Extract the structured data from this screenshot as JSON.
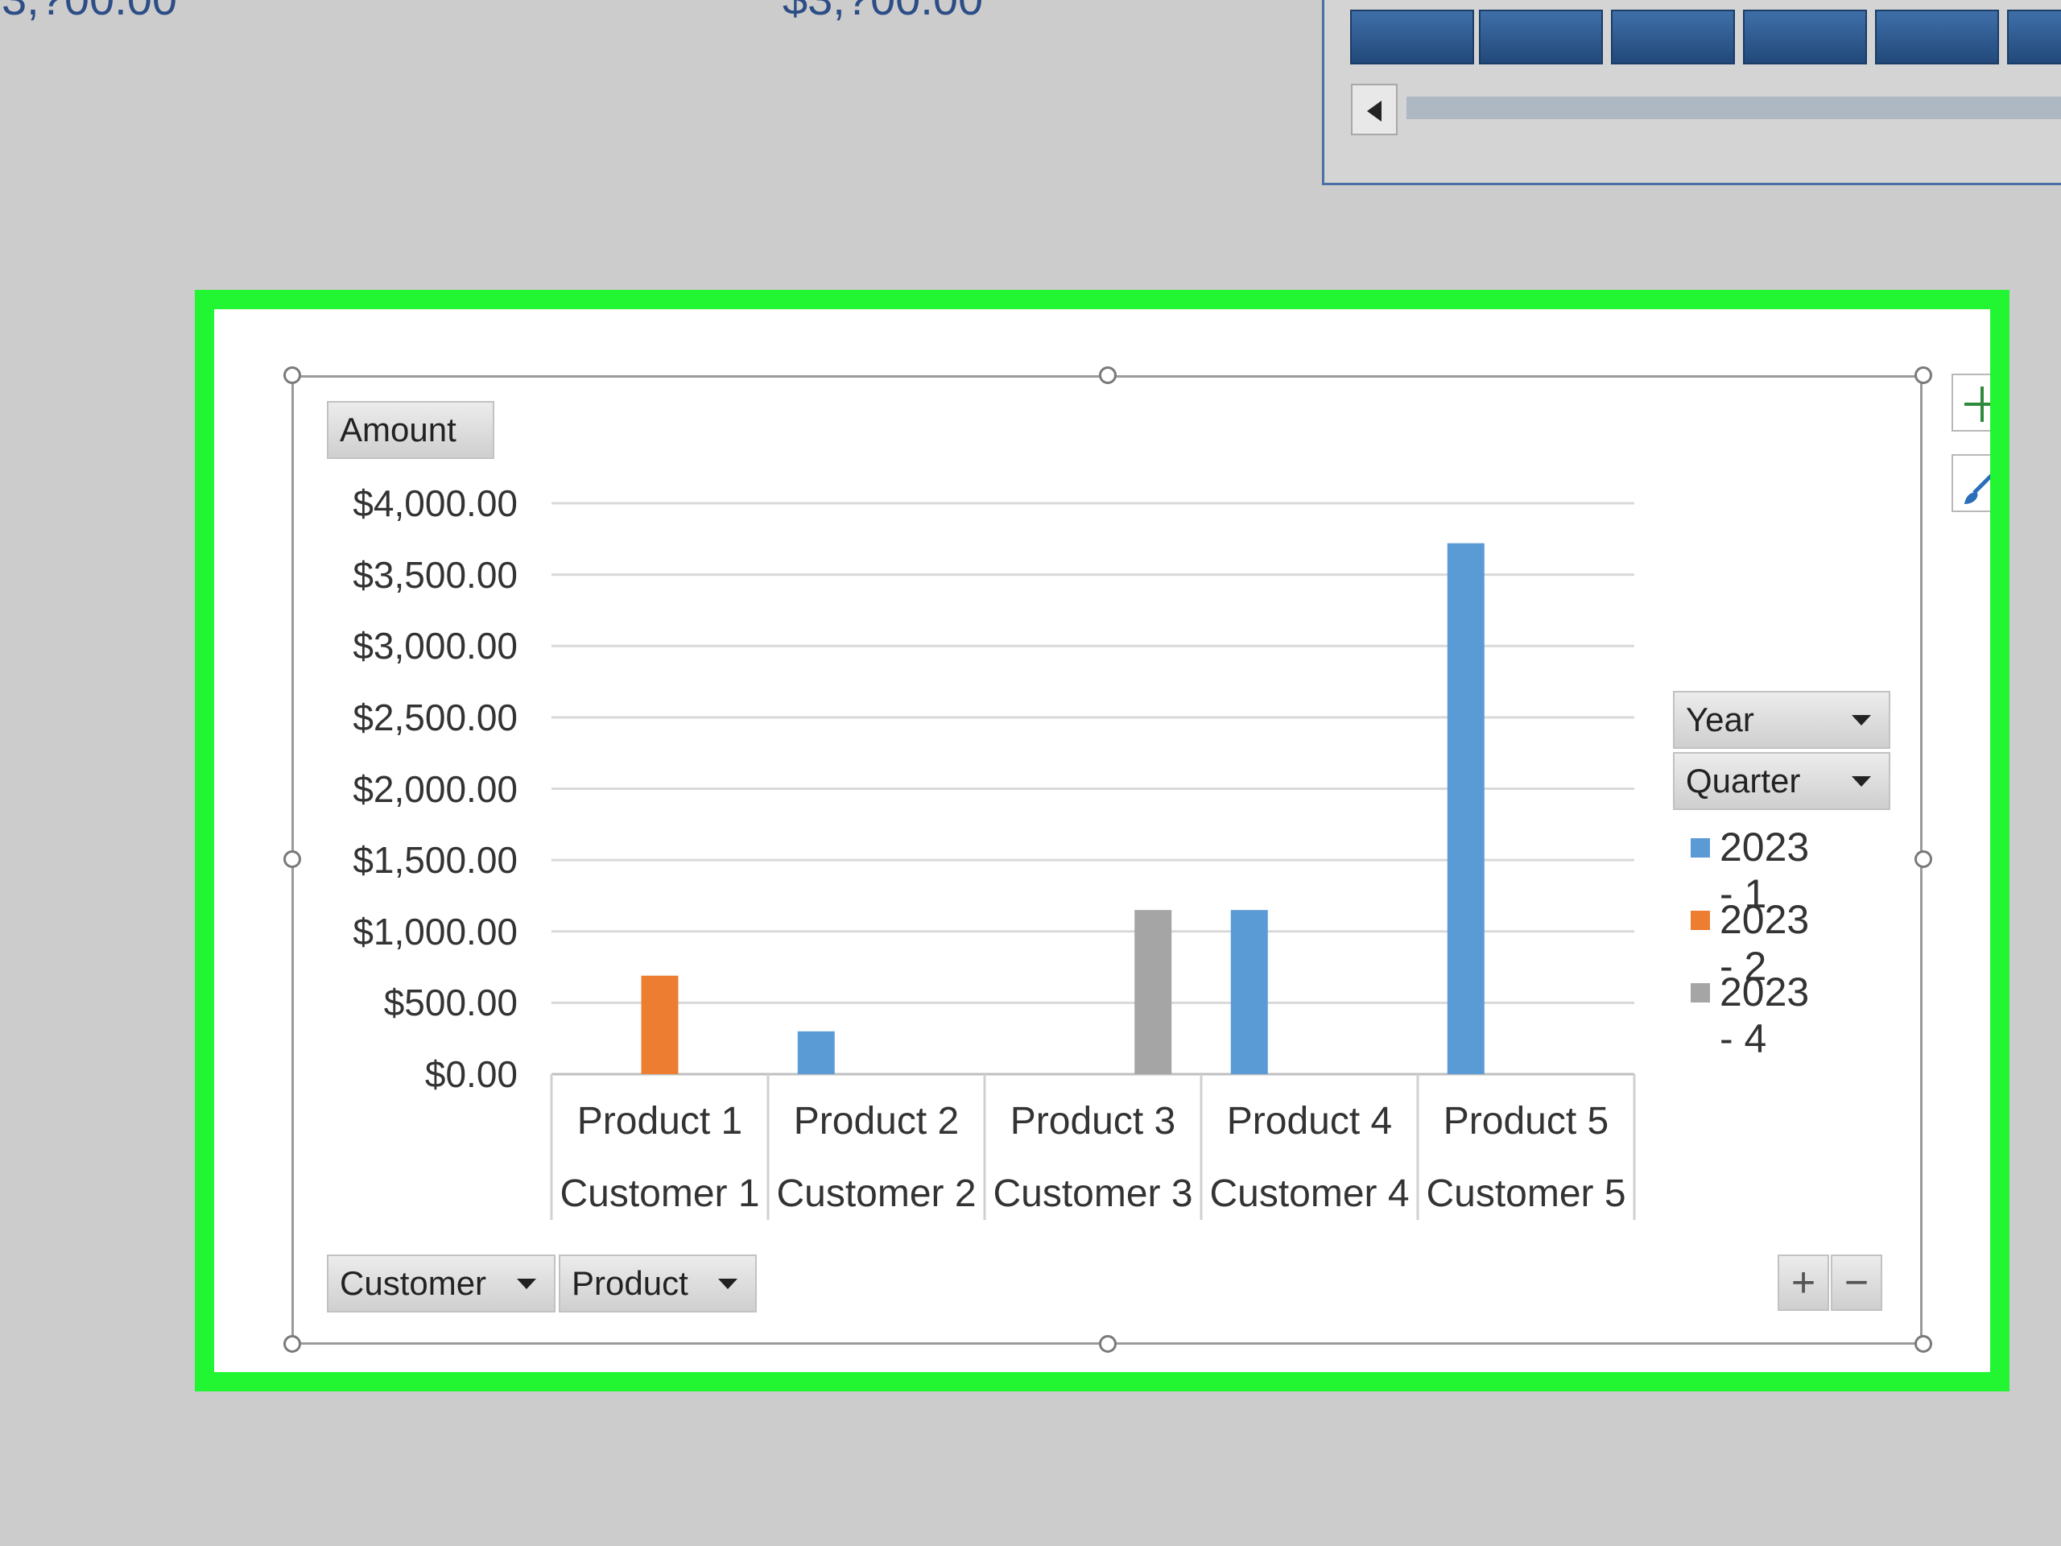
{
  "top_values": {
    "left": "3,?00.00",
    "middle": "$3,?00.00"
  },
  "chart": {
    "value_field_label": "Amount",
    "legend_fields": [
      {
        "label": "Year"
      },
      {
        "label": "Quarter"
      }
    ],
    "axis_fields": [
      {
        "label": "Customer"
      },
      {
        "label": "Product"
      }
    ],
    "zoom_in_label": "+",
    "zoom_out_label": "−",
    "colors": {
      "s1": "#5b9bd5",
      "s2": "#ed7d31",
      "s3": "#a5a5a5"
    }
  },
  "chart_data": {
    "type": "bar",
    "categories": [
      [
        "Product 1",
        "Customer 1"
      ],
      [
        "Product 2",
        "Customer 2"
      ],
      [
        "Product 3",
        "Customer 3"
      ],
      [
        "Product 4",
        "Customer 4"
      ],
      [
        "Product 5",
        "Customer 5"
      ]
    ],
    "series": [
      {
        "name": "2023 - 1",
        "values": [
          null,
          300,
          null,
          1150,
          3720
        ]
      },
      {
        "name": "2023 - 2",
        "values": [
          690,
          null,
          null,
          null,
          null
        ]
      },
      {
        "name": "2023 - 4",
        "values": [
          null,
          null,
          1150,
          null,
          null
        ]
      }
    ],
    "yticks": [
      "$0.00",
      "$500.00",
      "$1,000.00",
      "$1,500.00",
      "$2,000.00",
      "$2,500.00",
      "$3,000.00",
      "$3,500.00",
      "$4,000.00"
    ],
    "ylim": [
      0,
      4000
    ],
    "grid": true,
    "legend_position": "right"
  }
}
